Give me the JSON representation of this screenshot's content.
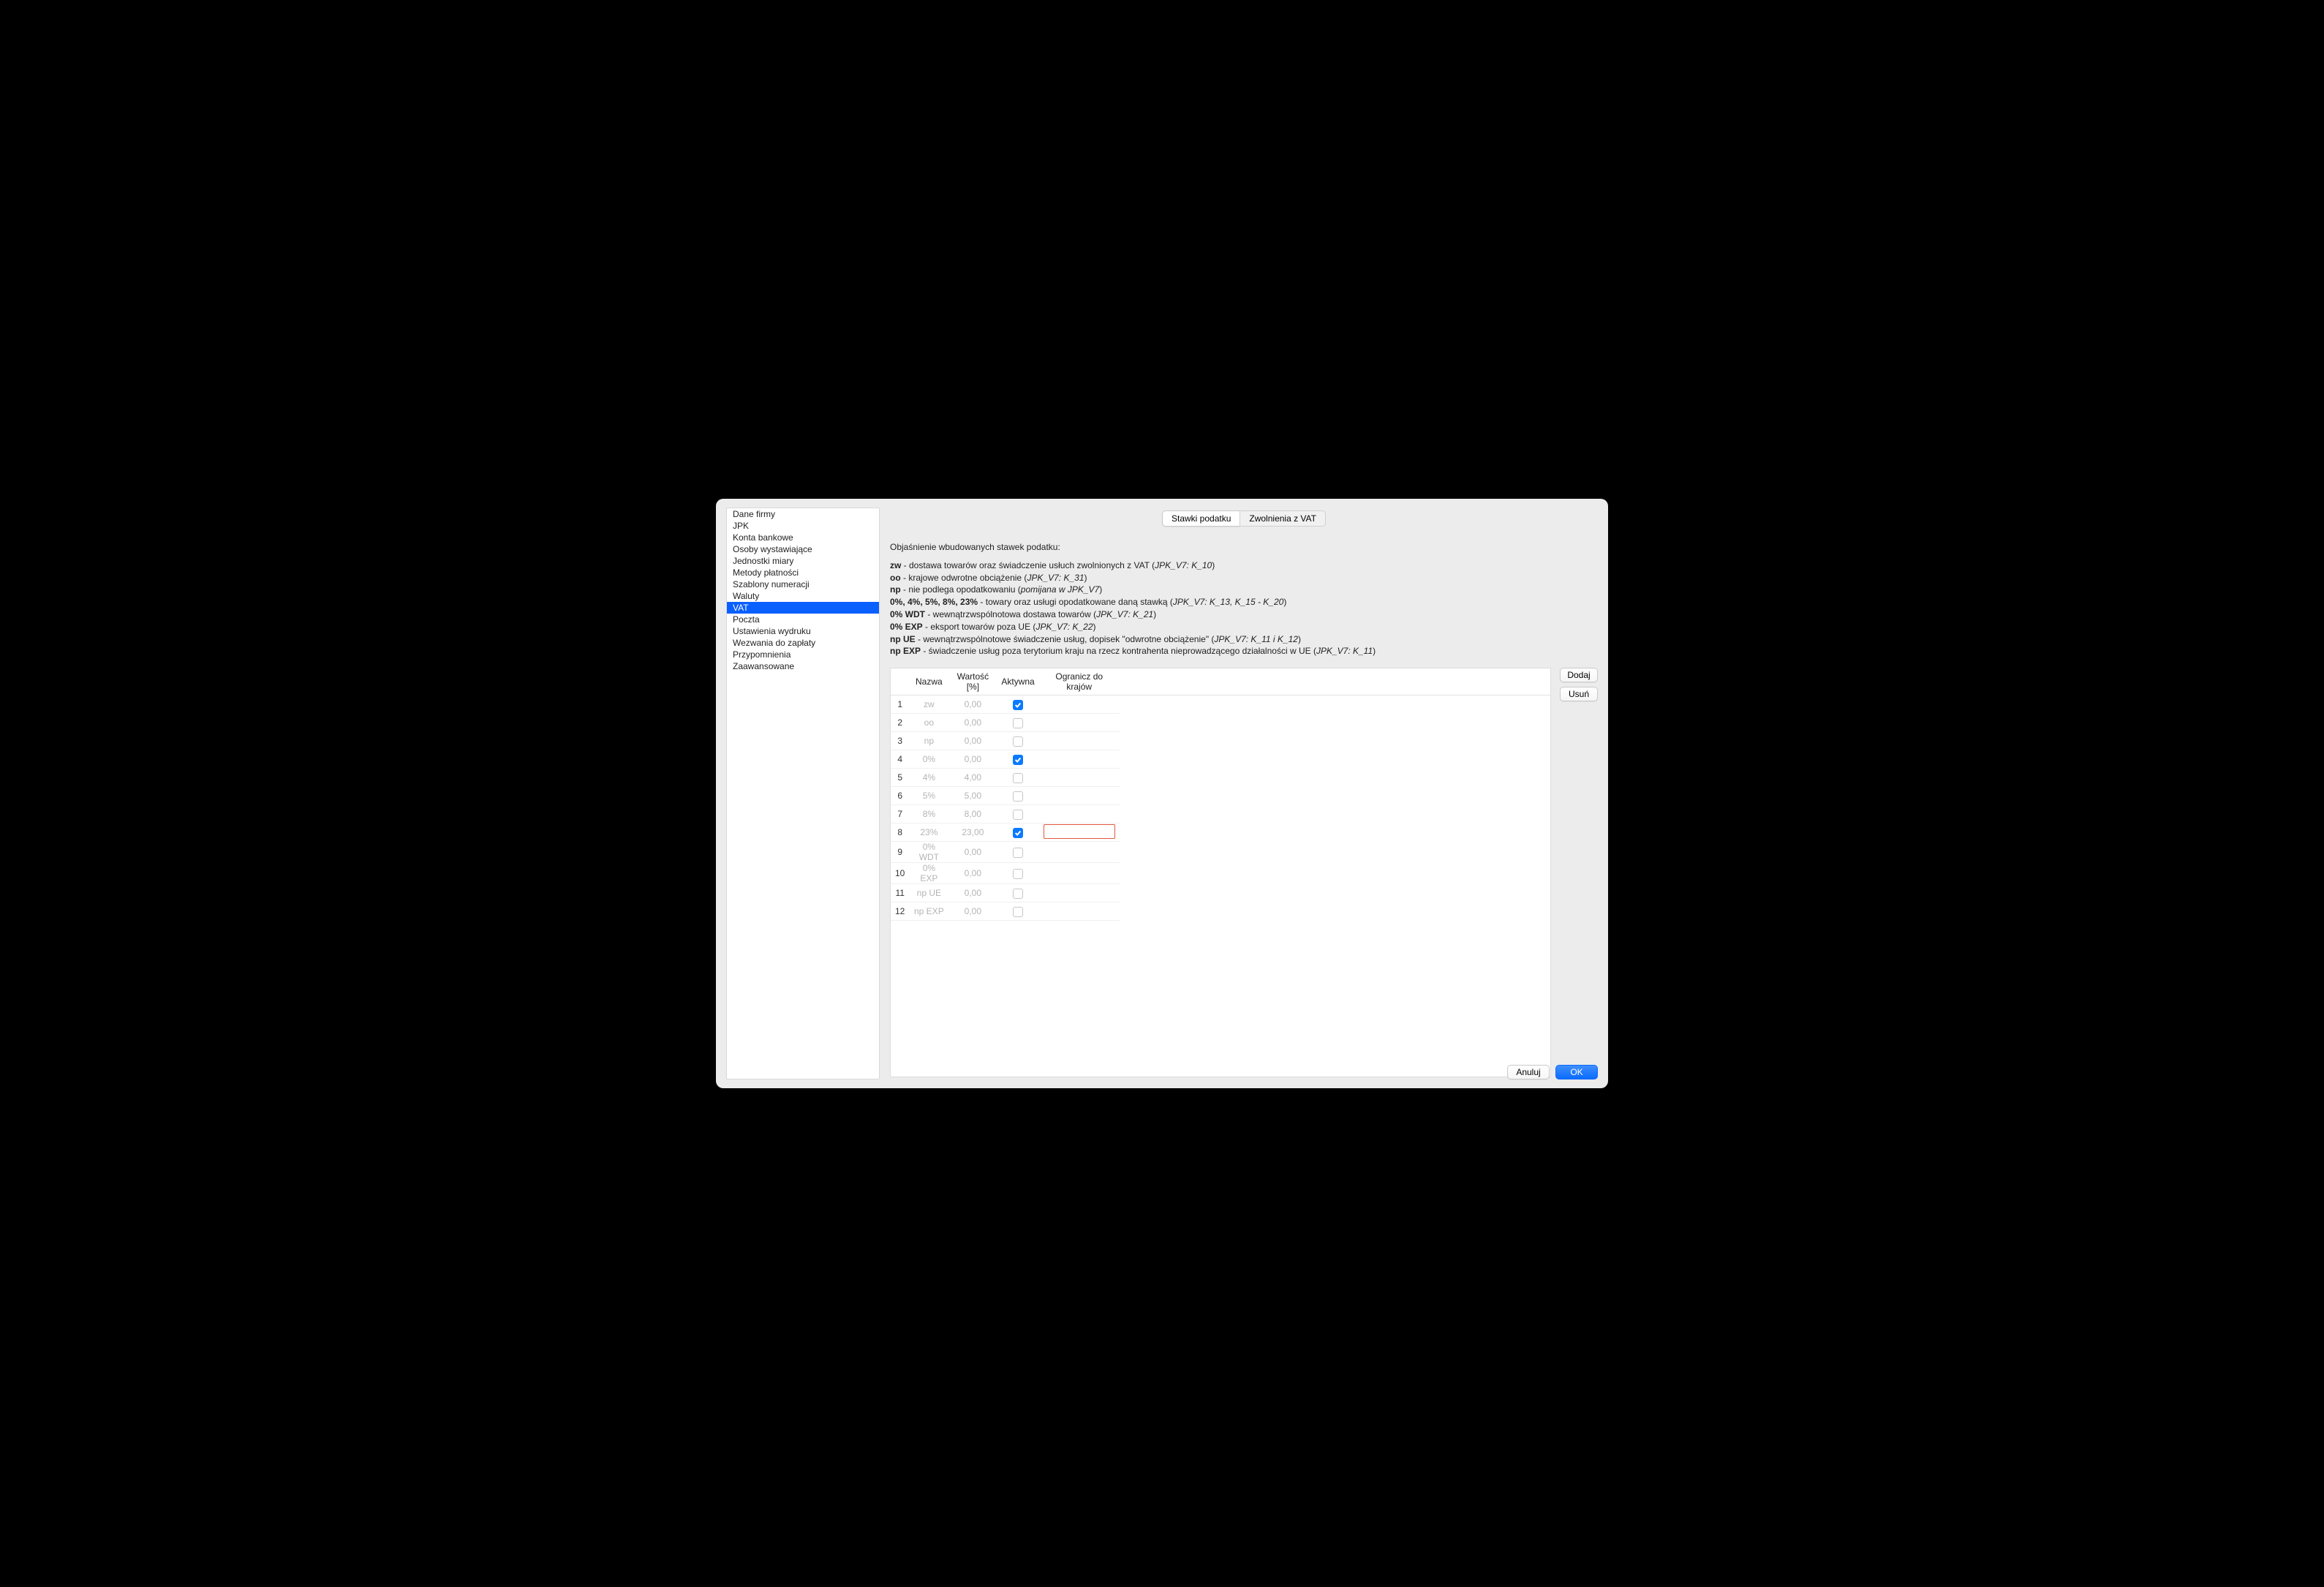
{
  "sidebar": {
    "items": [
      "Dane firmy",
      "JPK",
      "Konta bankowe",
      "Osoby wystawiające",
      "Jednostki miary",
      "Metody płatności",
      "Szablony numeracji",
      "Waluty",
      "VAT",
      "Poczta",
      "Ustawienia wydruku",
      "Wezwania do zapłaty",
      "Przypomnienia",
      "Zaawansowane"
    ],
    "selected_index": 8
  },
  "tabs": {
    "items": [
      "Stawki podatku",
      "Zwolnienia z VAT"
    ],
    "active_index": 0
  },
  "explain": {
    "title": "Objaśnienie wbudowanych stawek podatku:",
    "rows": [
      {
        "b": "zw",
        "txt": " - dostawa towarów oraz świadczenie usłuch zwolnionych z VAT (",
        "i": "JPK_V7: K_10",
        "post": ")"
      },
      {
        "b": "oo",
        "txt": " - krajowe odwrotne obciążenie (",
        "i": "JPK_V7: K_31",
        "post": ")"
      },
      {
        "b": "np",
        "txt": " - nie podlega opodatkowaniu (",
        "i": "pomijana w JPK_V7",
        "post": ")"
      },
      {
        "b": "0%, 4%, 5%, 8%, 23%",
        "txt": " - towary oraz usługi opodatkowane daną stawką (",
        "i": "JPK_V7: K_13, K_15 - K_20",
        "post": ")"
      },
      {
        "b": "0% WDT",
        "txt": " - wewnątrzwspólnotowa dostawa towarów (",
        "i": "JPK_V7: K_21",
        "post": ")"
      },
      {
        "b": "0% EXP",
        "txt": " - eksport towarów poza UE (",
        "i": "JPK_V7: K_22",
        "post": ")"
      },
      {
        "b": "np UE",
        "txt": " - wewnątrzwspólnotowe świadczenie usług, dopisek \"odwrotne obciążenie\" (",
        "i": "JPK_V7: K_11 i K_12",
        "post": ")"
      },
      {
        "b": "np EXP",
        "txt": " - świadczenie usług poza terytorium kraju na rzecz kontrahenta nieprowadzącego działalności w UE (",
        "i": "JPK_V7: K_11",
        "post": ")"
      }
    ]
  },
  "table": {
    "headers": [
      "",
      "Nazwa",
      "Wartość [%]",
      "Aktywna",
      "Ogranicz do krajów"
    ],
    "rows": [
      {
        "n": 1,
        "name": "zw",
        "val": "0,00",
        "active": true,
        "countries": ""
      },
      {
        "n": 2,
        "name": "oo",
        "val": "0,00",
        "active": false,
        "countries": ""
      },
      {
        "n": 3,
        "name": "np",
        "val": "0,00",
        "active": false,
        "countries": ""
      },
      {
        "n": 4,
        "name": "0%",
        "val": "0,00",
        "active": true,
        "countries": ""
      },
      {
        "n": 5,
        "name": "4%",
        "val": "4,00",
        "active": false,
        "countries": ""
      },
      {
        "n": 6,
        "name": "5%",
        "val": "5,00",
        "active": false,
        "countries": ""
      },
      {
        "n": 7,
        "name": "8%",
        "val": "8,00",
        "active": false,
        "countries": ""
      },
      {
        "n": 8,
        "name": "23%",
        "val": "23,00",
        "active": true,
        "countries": "",
        "highlight": true
      },
      {
        "n": 9,
        "name": "0% WDT",
        "val": "0,00",
        "active": false,
        "countries": ""
      },
      {
        "n": 10,
        "name": "0% EXP",
        "val": "0,00",
        "active": false,
        "countries": ""
      },
      {
        "n": 11,
        "name": "np UE",
        "val": "0,00",
        "active": false,
        "countries": ""
      },
      {
        "n": 12,
        "name": "np EXP",
        "val": "0,00",
        "active": false,
        "countries": ""
      }
    ]
  },
  "buttons": {
    "add": "Dodaj",
    "remove": "Usuń",
    "cancel": "Anuluj",
    "ok": "OK"
  }
}
